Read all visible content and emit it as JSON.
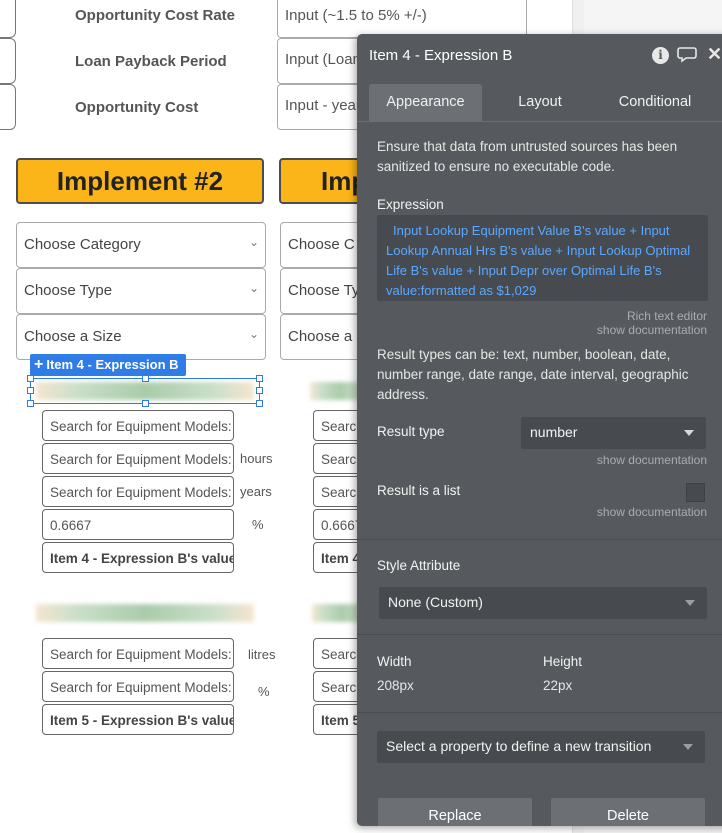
{
  "canvas": {
    "rows": [
      {
        "label": "Opportunity Cost Rate",
        "input": "Input (~1.5 to 5% +/-)"
      },
      {
        "label": "Loan Payback Period",
        "input": "Input (Loan"
      },
      {
        "label": "Opportunity Cost",
        "input": "Input - year"
      }
    ],
    "implement_buttons": [
      "Implement #2",
      "Imp"
    ],
    "col1_dropdowns": [
      "Choose Category",
      "Choose Type",
      "Choose a Size"
    ],
    "col2_dropdowns": [
      "Choose C",
      "Choose Ty",
      "Choose a"
    ],
    "selection_label": "Item 4 - Expression B",
    "group1_fields": [
      "Search for Equipment Models:",
      "Search for Equipment Models:",
      "Search for Equipment Models:",
      "0.6667",
      "Item 4 - Expression B's value"
    ],
    "group1_units": [
      "hours",
      "years",
      "%"
    ],
    "group1_col2_fields": [
      "Searc",
      "Searc",
      "Searc",
      "0.6667",
      "Item 4"
    ],
    "group2_fields": [
      "Search for Equipment Models:",
      "Search for Equipment Models:",
      "Item 5 - Expression B's value"
    ],
    "group2_units": [
      "litres",
      "%"
    ],
    "group2_col2_fields": [
      "Searc",
      "Searc",
      "Item 5"
    ]
  },
  "panel": {
    "title": "Item 4 - Expression B",
    "icons": [
      "info-icon",
      "comment-icon",
      "close-icon"
    ],
    "info_glyph": "i",
    "tabs": [
      "Appearance",
      "Layout",
      "Conditional"
    ],
    "active_tab": "Appearance",
    "warning": "Ensure that data from untrusted sources has been sanitized to ensure no executable code.",
    "expression_label": "Expression",
    "expression_text": "Input Lookup Equipment Value B's value + Input Lookup Annual Hrs B's value + Input Lookup Optimal Life B's value + Input Depr over Optimal Life B's value:formatted as $1,029",
    "rich_text_editor": "Rich text editor",
    "show_documentation": "show documentation",
    "result_types_text": "Result types can be: text, number, boolean, date, number range, date range, date interval, geographic address.",
    "result_type_label": "Result type",
    "result_type_value": "number",
    "result_is_list_label": "Result is a list",
    "result_is_list": false,
    "style_attribute_label": "Style Attribute",
    "style_attribute_value": "None (Custom)",
    "width_label": "Width",
    "width_value": "208px",
    "height_label": "Height",
    "height_value": "22px",
    "transition_placeholder": "Select a property to define a new transition",
    "replace_button": "Replace",
    "delete_button": "Delete"
  }
}
